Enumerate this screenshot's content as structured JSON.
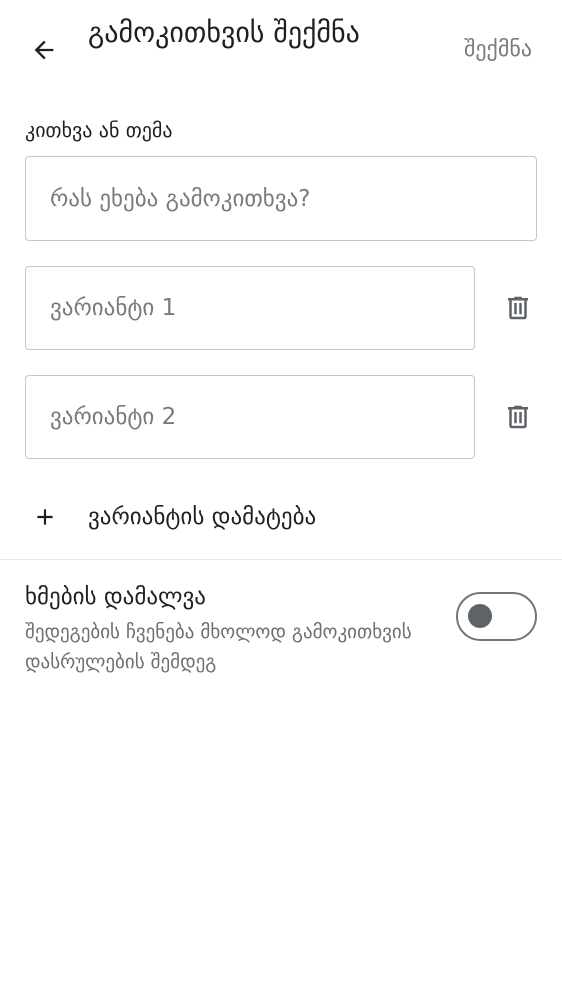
{
  "header": {
    "title": "გამოკითხვის შექმნა",
    "create_label": "შექმნა"
  },
  "form": {
    "question_label": "კითხვა ან თემა",
    "question_placeholder": "რას ეხება გამოკითხვა?",
    "options": [
      {
        "placeholder": "ვარიანტი 1"
      },
      {
        "placeholder": "ვარიანტი 2"
      }
    ],
    "add_option_label": "ვარიანტის დამატება"
  },
  "settings": {
    "hide_votes": {
      "title": "ხმების დამალვა",
      "description": "შედეგების ჩვენება მხოლოდ გამოკითხვის დასრულების შემდეგ",
      "enabled": false
    }
  },
  "colors": {
    "text_primary": "#1f1f1f",
    "text_secondary": "#6e6e6e",
    "border": "#c7c7c7",
    "toggle_off": "#5f6368"
  },
  "icons": {
    "back": "arrow-back-icon",
    "delete": "trash-icon",
    "add": "plus-icon"
  }
}
